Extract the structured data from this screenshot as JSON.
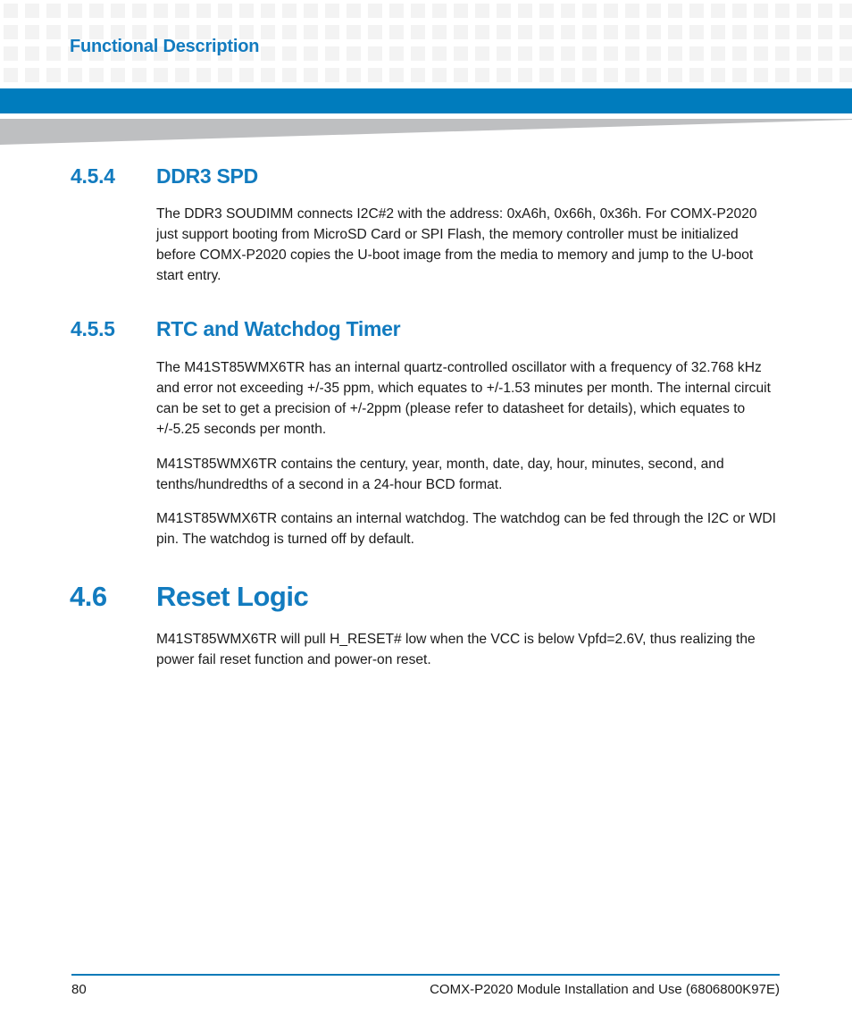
{
  "header": {
    "chapter_title": "Functional Description"
  },
  "sections": [
    {
      "number": "4.5.4",
      "title": "DDR3 SPD",
      "paragraphs": [
        "The DDR3 SOUDIMM connects I2C#2 with the address: 0xA6h, 0x66h, 0x36h. For COMX-P2020 just support booting from MicroSD Card or SPI Flash, the memory controller must be initialized before COMX-P2020 copies the U-boot image from the media to memory and jump to the U-boot start entry."
      ]
    },
    {
      "number": "4.5.5",
      "title": "RTC and Watchdog Timer",
      "paragraphs": [
        "The M41ST85WMX6TR has an internal quartz-controlled oscillator with a frequency of 32.768 kHz and error not exceeding +/-35 ppm, which equates to +/-1.53 minutes per month. The internal circuit can be set to get a precision of +/-2ppm (please refer to datasheet for details), which equates to +/-5.25 seconds per month.",
        "M41ST85WMX6TR contains the century, year, month, date, day, hour, minutes, second, and tenths/hundredths of a second in a 24-hour BCD format.",
        "M41ST85WMX6TR contains an internal watchdog. The watchdog can be fed through the I2C or WDI pin. The watchdog is turned off by default."
      ]
    },
    {
      "number": "4.6",
      "title": "Reset Logic",
      "paragraphs": [
        "M41ST85WMX6TR will pull H_RESET# low when the VCC is below Vpfd=2.6V, thus realizing the power fail reset function and power-on reset."
      ]
    }
  ],
  "footer": {
    "page_number": "80",
    "document_title": "COMX-P2020 Module Installation and Use (6806800K97E)"
  },
  "colors": {
    "accent_blue": "#007cbd",
    "heading_blue": "#127bbf",
    "wedge_gray": "#bebfc1"
  }
}
